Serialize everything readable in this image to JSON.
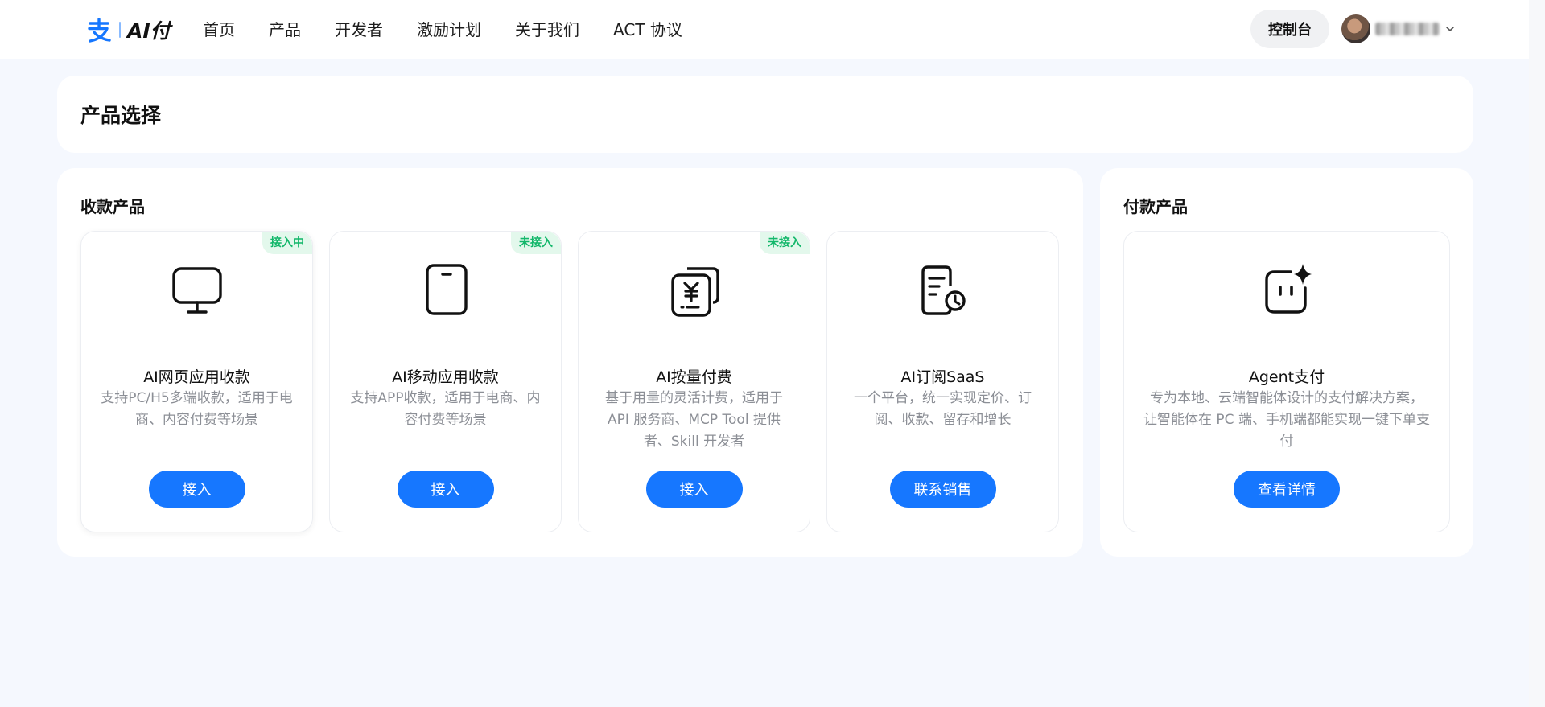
{
  "header": {
    "logo_text": "AI付",
    "nav": [
      "首页",
      "产品",
      "开发者",
      "激励计划",
      "关于我们",
      "ACT 协议"
    ],
    "console_label": "控制台"
  },
  "page": {
    "title": "产品选择"
  },
  "receive": {
    "title": "收款产品",
    "cards": [
      {
        "name": "AI网页应用收款",
        "desc": "支持PC/H5多端收款，适用于电商、内容付费等场景",
        "tag": "接入中",
        "button": "接入",
        "icon": "monitor-icon"
      },
      {
        "name": "AI移动应用收款",
        "desc": "支持APP收款，适用于电商、内容付费等场景",
        "tag": "未接入",
        "button": "接入",
        "icon": "mobile-icon"
      },
      {
        "name": "AI按量付费",
        "desc": "基于用量的灵活计费，适用于 API 服务商、MCP Tool 提供者、Skill 开发者",
        "tag": "未接入",
        "button": "接入",
        "icon": "yuan-bill-icon"
      },
      {
        "name": "AI订阅SaaS",
        "desc": "一个平台，统一实现定价、订阅、收款、留存和增长",
        "button": "联系销售",
        "icon": "subscription-doc-icon"
      }
    ]
  },
  "pay": {
    "title": "付款产品",
    "cards": [
      {
        "name": "Agent支付",
        "desc": "专为本地、云端智能体设计的支付解决方案，让智能体在 PC 端、手机端都能实现一键下单支付",
        "button": "查看详情",
        "icon": "agent-sparkle-icon"
      }
    ]
  },
  "colors": {
    "primary": "#1677ff",
    "page_bg": "#f5f8fe",
    "tag_bg": "#e3f8ec",
    "tag_text": "#12b76a",
    "muted_text": "#8c8f96"
  }
}
